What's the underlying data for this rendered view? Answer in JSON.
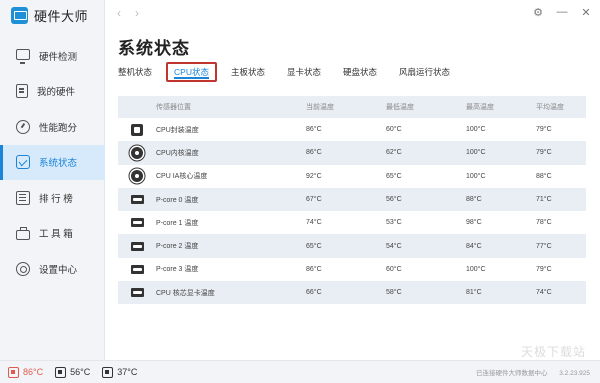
{
  "app": {
    "title": "硬件大师"
  },
  "sidebar": {
    "items": [
      {
        "label": "硬件检测",
        "icon": "monitor-icon"
      },
      {
        "label": "我的硬件",
        "icon": "document-icon"
      },
      {
        "label": "性能跑分",
        "icon": "gauge-icon"
      },
      {
        "label": "系统状态",
        "icon": "status-icon",
        "active": true
      },
      {
        "label": "排 行 榜",
        "icon": "ranking-icon"
      },
      {
        "label": "工 具 箱",
        "icon": "toolbox-icon"
      },
      {
        "label": "设置中心",
        "icon": "settings-icon"
      }
    ]
  },
  "topbar": {
    "back": "‹",
    "forward": "›",
    "settings_glyph": "⚙",
    "minimize_glyph": "—",
    "close_glyph": "✕"
  },
  "page": {
    "title": "系统状态"
  },
  "tabs": [
    "整机状态",
    "CPU状态",
    "主板状态",
    "显卡状态",
    "硬盘状态",
    "风扇运行状态"
  ],
  "active_tab": 1,
  "table": {
    "headers": [
      "传感器位置",
      "当前温度",
      "最低温度",
      "最高温度",
      "平均温度"
    ],
    "rows": [
      {
        "icon": "cpu-package-icon",
        "name": "CPU封装温度",
        "cur": "86°C",
        "min": "60°C",
        "max": "100°C",
        "avg": "79°C"
      },
      {
        "icon": "cpu-core-icon",
        "name": "CPU内核温度",
        "cur": "86°C",
        "min": "62°C",
        "max": "100°C",
        "avg": "79°C"
      },
      {
        "icon": "cpu-core-icon",
        "name": "CPU IA核心温度",
        "cur": "92°C",
        "min": "65°C",
        "max": "100°C",
        "avg": "88°C"
      },
      {
        "icon": "core-icon",
        "name": "P-core 0 温度",
        "cur": "67°C",
        "min": "56°C",
        "max": "88°C",
        "avg": "71°C"
      },
      {
        "icon": "core-icon",
        "name": "P-core 1 温度",
        "cur": "74°C",
        "min": "53°C",
        "max": "98°C",
        "avg": "78°C"
      },
      {
        "icon": "core-icon",
        "name": "P-core 2 温度",
        "cur": "65°C",
        "min": "54°C",
        "max": "84°C",
        "avg": "77°C"
      },
      {
        "icon": "core-icon",
        "name": "P-core 3 温度",
        "cur": "86°C",
        "min": "60°C",
        "max": "100°C",
        "avg": "79°C"
      },
      {
        "icon": "gpu-core-icon",
        "name": "CPU 核芯显卡温度",
        "cur": "66°C",
        "min": "58°C",
        "max": "81°C",
        "avg": "74°C"
      }
    ]
  },
  "footer": {
    "cpu_temp": "86°C",
    "gpu_temp": "56°C",
    "disk_temp": "37°C",
    "status": "已连接硬件大师数据中心",
    "version": "3.2.23.925"
  },
  "watermark": "天极下载站",
  "colors": {
    "accent": "#1b84d8",
    "hot": "#e05a4e",
    "tab_highlight": "#c0352d"
  }
}
